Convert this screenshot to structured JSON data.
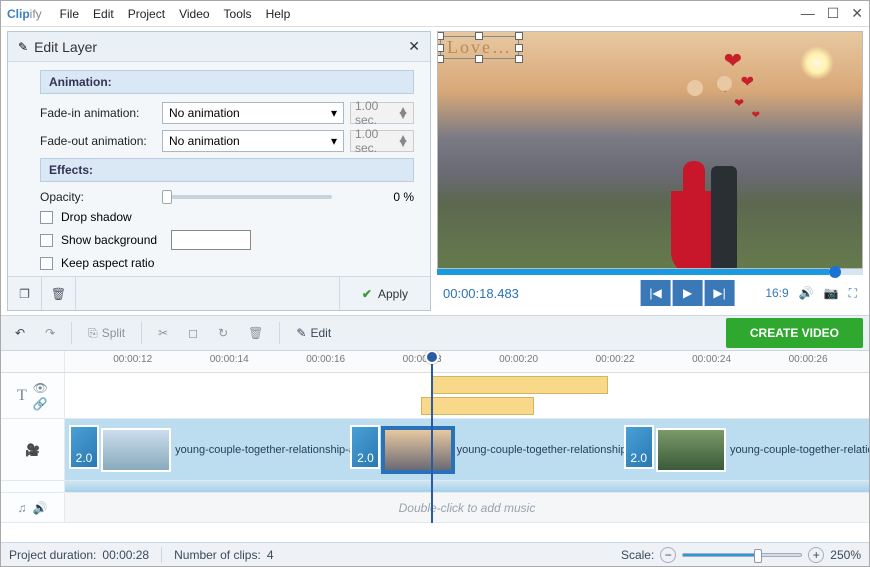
{
  "app": {
    "brand_a": "Clip",
    "brand_b": "ify"
  },
  "menu": {
    "items": [
      "File",
      "Edit",
      "Project",
      "Video",
      "Tools",
      "Help"
    ]
  },
  "edit_layer": {
    "title": "Edit Layer",
    "animation_hdr": "Animation:",
    "fadein_label": "Fade-in animation:",
    "fadeout_label": "Fade-out animation:",
    "no_anim": "No animation",
    "sec": "1.00 sec.",
    "effects_hdr": "Effects:",
    "opacity_label": "Opacity:",
    "opacity_value": "0 %",
    "drop_shadow": "Drop shadow",
    "show_bg": "Show background",
    "keep_ar": "Keep aspect ratio",
    "apply": "Apply"
  },
  "preview": {
    "love_text": "Love…",
    "timecode": "00:00:18.483",
    "aspect": "16:9",
    "play_pct": 92
  },
  "toolbar": {
    "split": "Split",
    "edit": "Edit",
    "create": "CREATE VIDEO"
  },
  "ruler": {
    "ticks": [
      "00:00:12",
      "00:00:14",
      "00:00:16",
      "00:00:18",
      "00:00:20",
      "00:00:22",
      "00:00:24",
      "00:00:26"
    ],
    "playhead_pct": 47
  },
  "timeline": {
    "clip_label": "young-couple-together-relationship-and",
    "trans_label": "2.0",
    "audio_hint": "Double-click to add music"
  },
  "status": {
    "duration_label": "Project duration:",
    "duration_value": "00:00:28",
    "clips_label": "Number of clips:",
    "clips_value": "4",
    "scale_label": "Scale:",
    "scale_value": "250%"
  }
}
